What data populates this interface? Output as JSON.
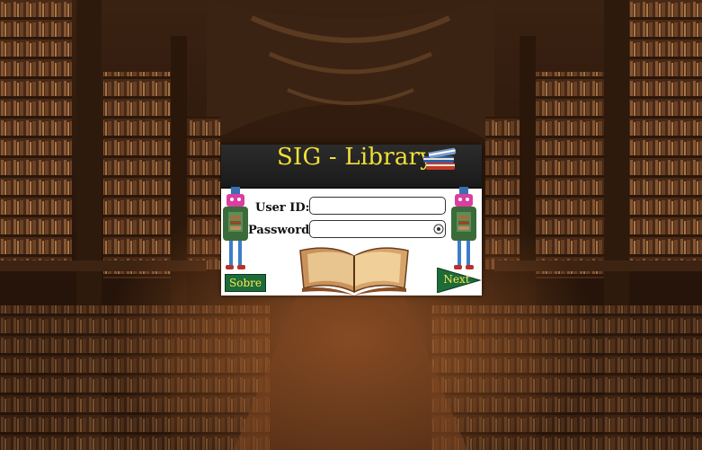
{
  "login": {
    "title": "SIG - Library",
    "user_id_label": "User ID:",
    "password_label": "Password:",
    "user_id_value": "",
    "password_value": "",
    "sobre_label": "Sobre",
    "next_label": "Next"
  },
  "icons": {
    "title_icon": "books-stack-icon",
    "password_toggle": "eye-icon",
    "decoration_left": "robot-character",
    "decoration_right": "robot-character",
    "decoration_center": "open-book"
  },
  "colors": {
    "title_text": "#f1df35",
    "button_green": "#1d6b3a",
    "button_text": "#ffe64a",
    "titlebar": "#222222"
  }
}
